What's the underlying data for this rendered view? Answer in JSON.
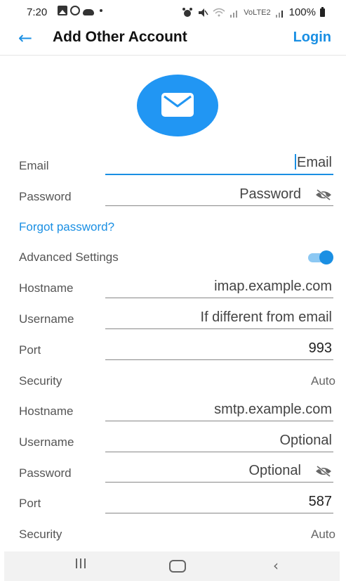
{
  "status_bar": {
    "time": "7:20",
    "left_icons": [
      "gallery-icon",
      "whatsapp-icon",
      "cloud-icon",
      "dot-icon"
    ],
    "volte_label": "VoLTE2",
    "battery": "100%"
  },
  "app_bar": {
    "back_icon": "arrow-left-icon",
    "title": "Add Other Account",
    "login_label": "Login"
  },
  "avatar": {
    "icon": "mail-icon",
    "color": "#2196f3"
  },
  "account": {
    "email_label": "Email",
    "email_placeholder": "Email",
    "password_label": "Password",
    "password_placeholder": "Password",
    "forgot_password": "Forgot password?"
  },
  "advanced": {
    "label": "Advanced Settings",
    "enabled": true
  },
  "incoming": {
    "hostname_label": "Hostname",
    "hostname_placeholder": "imap.example.com",
    "username_label": "Username",
    "username_placeholder": "If different from email",
    "port_label": "Port",
    "port_value": "993",
    "security_label": "Security",
    "security_value": "Auto"
  },
  "outgoing": {
    "hostname_label": "Hostname",
    "hostname_placeholder": "smtp.example.com",
    "username_label": "Username",
    "username_placeholder": "Optional",
    "password_label": "Password",
    "password_placeholder": "Optional",
    "port_label": "Port",
    "port_value": "587",
    "security_label": "Security",
    "security_value": "Auto"
  },
  "colors": {
    "accent": "#1a8fe3",
    "avatar": "#2196f3"
  },
  "nav_bar": {
    "recents_icon": "recents-icon",
    "home_icon": "home-icon",
    "back_icon": "back-icon"
  }
}
